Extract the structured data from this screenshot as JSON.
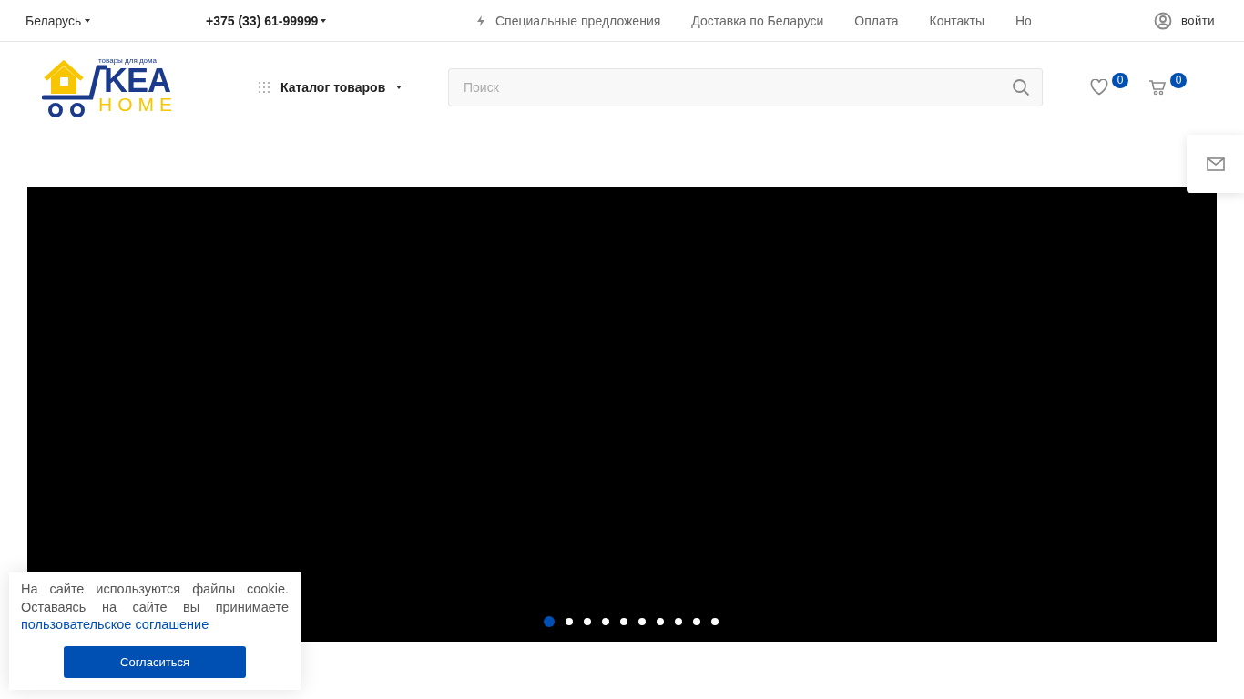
{
  "top_bar": {
    "region": "Беларусь",
    "phone": "+375 (33) 61-99999",
    "nav": [
      {
        "label": "Специальные предложения",
        "kind": "special"
      },
      {
        "label": "Доставка по Беларуси",
        "kind": "plain"
      },
      {
        "label": "Оплата",
        "kind": "plain"
      },
      {
        "label": "Контакты",
        "kind": "plain"
      },
      {
        "label": "Но",
        "kind": "plain"
      }
    ],
    "login": "войти"
  },
  "header": {
    "logo": {
      "tagline": "товары для дома",
      "word": "KEA",
      "sub": "HOME"
    },
    "catalog": "Каталог товаров",
    "search": {
      "placeholder": "Поиск"
    },
    "favorites_count": "0",
    "cart_count": "0"
  },
  "slider": {
    "dots": [
      {
        "selected": true
      },
      {
        "selected": false
      },
      {
        "selected": false
      },
      {
        "selected": false
      },
      {
        "selected": false
      },
      {
        "selected": false
      },
      {
        "selected": false
      },
      {
        "selected": false
      },
      {
        "selected": false
      },
      {
        "selected": false
      }
    ]
  },
  "cookie": {
    "text": "На сайте используются файлы cookie. Оставаясь на сайте вы принимаете",
    "link": "пользовательское соглашение",
    "button": "Согласиться"
  }
}
